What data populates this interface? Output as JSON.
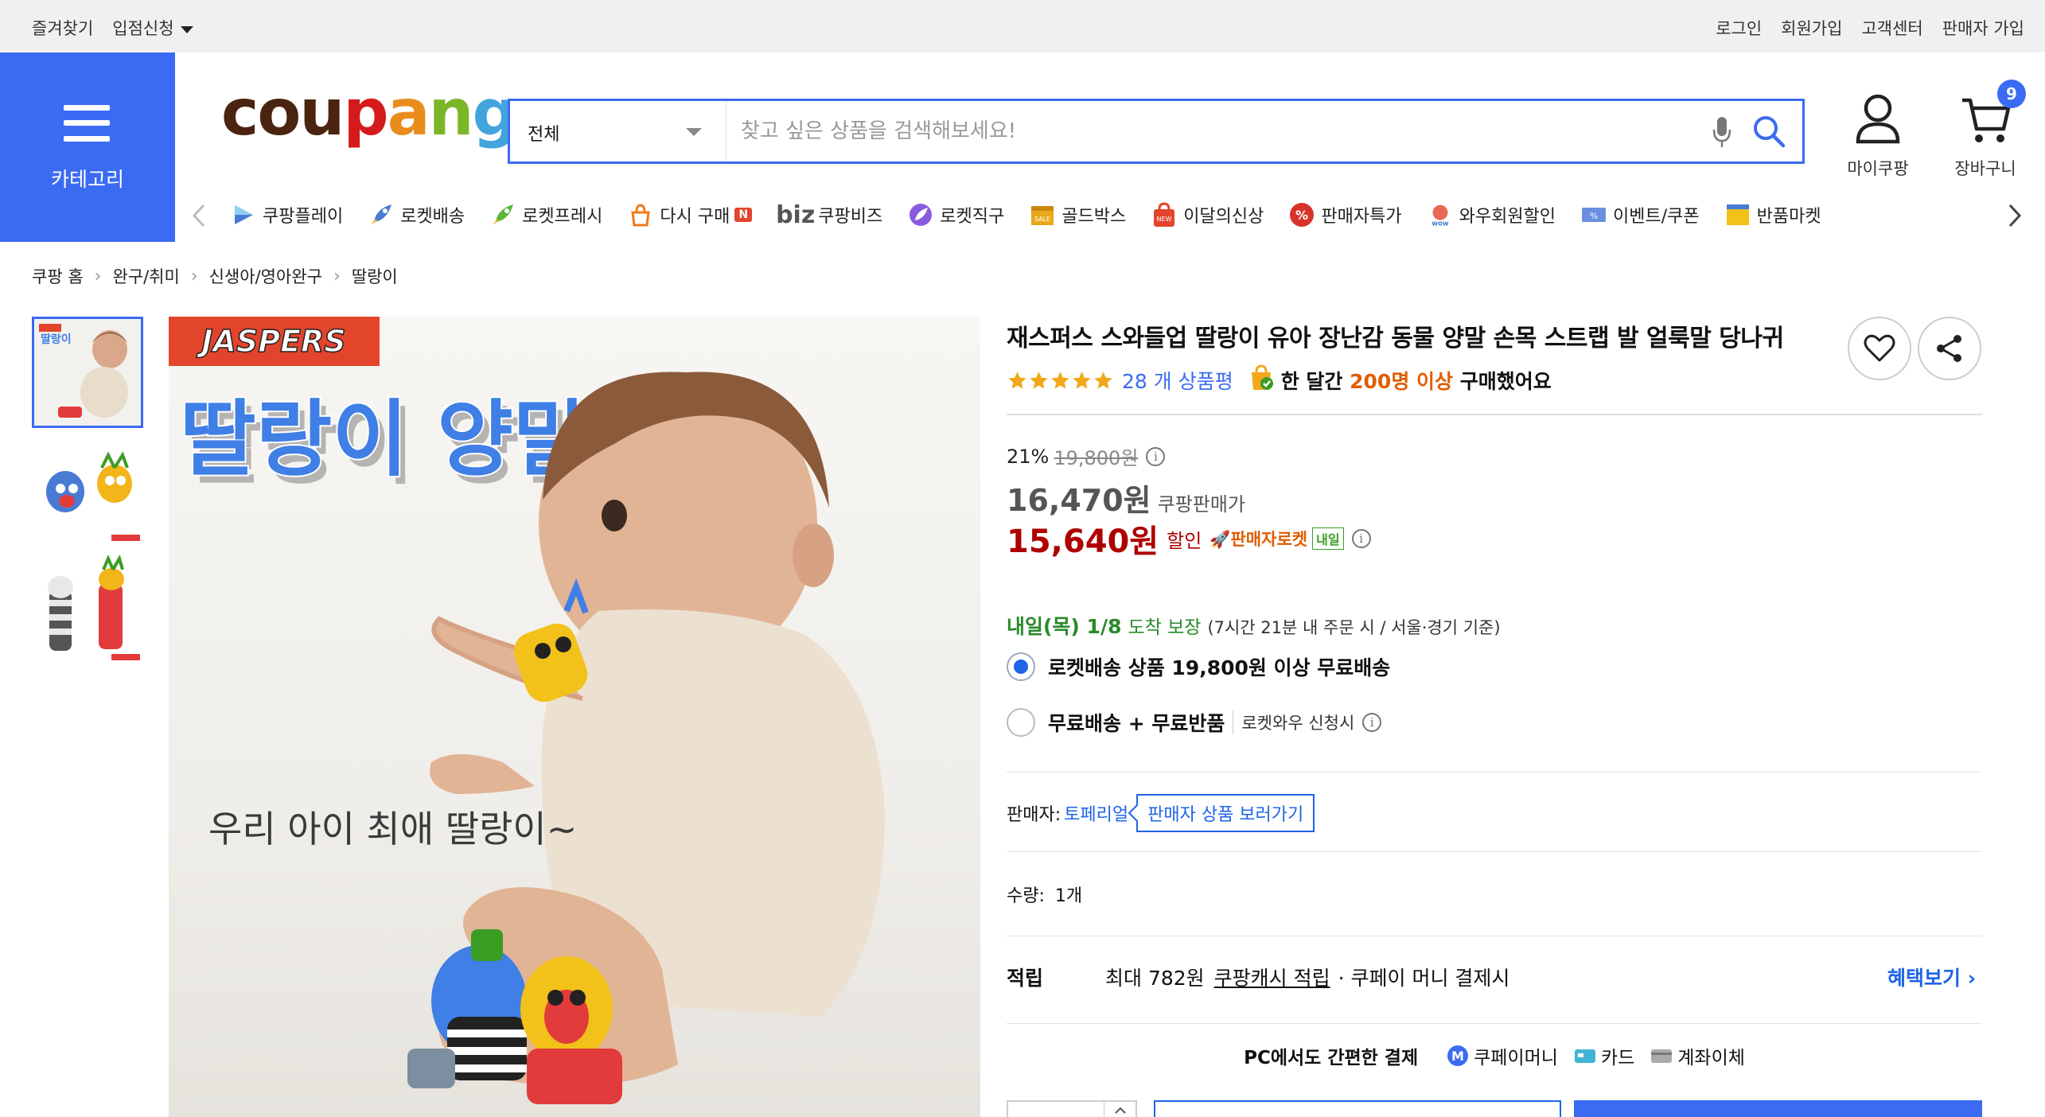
{
  "topbar": {
    "bookmark": "즐겨찾기",
    "apply": "입점신청",
    "login": "로그인",
    "signup": "회원가입",
    "support": "고객센터",
    "seller_signup": "판매자 가입"
  },
  "category": {
    "label": "카테고리"
  },
  "logo": {
    "letters": [
      "c",
      "o",
      "u",
      "p",
      "a",
      "n",
      "g"
    ],
    "colors": [
      "#4a2410",
      "#4a2410",
      "#4a2410",
      "#d41a1a",
      "#e98c1c",
      "#7ab728",
      "#41a4dd"
    ]
  },
  "search": {
    "category": "전체",
    "placeholder": "찾고 싶은 상품을 검색해보세요!"
  },
  "header": {
    "mypage": "마이쿠팡",
    "cart": "장바구니",
    "cart_count": "9"
  },
  "nav": {
    "items": [
      {
        "label": "쿠팡플레이",
        "icon": "play-icon"
      },
      {
        "label": "로켓배송",
        "icon": "rocket-icon"
      },
      {
        "label": "로켓프레시",
        "icon": "fresh-rocket-icon"
      },
      {
        "label": "다시 구매",
        "icon": "rebuy-icon",
        "badge": "N"
      },
      {
        "label": "쿠팡비즈",
        "icon": "biz-icon",
        "prefix": "biz"
      },
      {
        "label": "로켓직구",
        "icon": "global-rocket-icon"
      },
      {
        "label": "골드박스",
        "icon": "goldbox-icon"
      },
      {
        "label": "이달의신상",
        "icon": "new-bag-icon"
      },
      {
        "label": "판매자특가",
        "icon": "percent-icon"
      },
      {
        "label": "와우회원할인",
        "icon": "wow-icon"
      },
      {
        "label": "이벤트/쿠폰",
        "icon": "coupon-icon"
      },
      {
        "label": "반품마켓",
        "icon": "return-market-icon"
      }
    ]
  },
  "breadcrumb": [
    "쿠팡 홈",
    "완구/취미",
    "신생아/영아완구",
    "딸랑이"
  ],
  "image": {
    "brand": "JASPERS",
    "headline": "딸랑이 양말",
    "caption": "우리 아이 최애 딸랑이~"
  },
  "product": {
    "title": "재스퍼스 스와들업 딸랑이 유아 장난감 동물 양말 손목 스트랩 발 얼룩말 당나귀",
    "rating": 5,
    "review_count": "28 개 상품평",
    "purchase_pre": "한 달간 ",
    "purchase_highlight": "200명 이상",
    "purchase_post": " 구매했어요",
    "discount_rate": "21%",
    "original_price": "19,800원",
    "price": "16,470원",
    "price_label": "쿠팡판매가",
    "sale_price": "15,640원",
    "sale_label": "할인",
    "rocket_label": "판매자로켓",
    "tomorrow_tag": "내일",
    "delivery_date": "내일(목) 1/8",
    "delivery_guarantee": "도착 보장",
    "delivery_detail": "(7시간 21분 내 주문 시 / 서울·경기 기준)",
    "shipping_option_1": "로켓배송 상품 19,800원 이상 무료배송",
    "shipping_option_2": "무료배송 + 무료반품",
    "shipping_option_2_sub": "로켓와우 신청시",
    "seller_label": "판매자:",
    "seller_name": "토페리얼",
    "seller_button": "판매자 상품 보러가기",
    "qty_label": "수량:",
    "qty_value": "1개",
    "points_label": "적립",
    "points_max": "최대 782원",
    "points_link": "쿠팡캐시 적립",
    "points_desc": "· 쿠페이 머니 결제시",
    "benefit_link": "혜택보기",
    "pay_lead": "PC에서도 간편한 결제",
    "pay_options": [
      "쿠페이머니",
      "카드",
      "계좌이체"
    ]
  },
  "colors": {
    "accent": "#3b6bf3",
    "sale": "#ae0000",
    "delivery": "#2a8a2a",
    "link": "#1e64e6"
  }
}
